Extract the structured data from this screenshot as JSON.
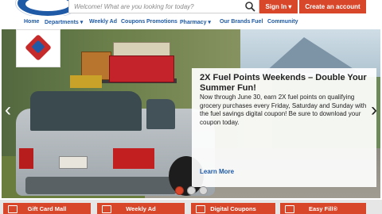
{
  "header": {
    "search_placeholder": "Welcome! What are you looking for today?",
    "signin_label": "Sign In ▾",
    "create_account_label": "Create an account"
  },
  "nav": {
    "items": [
      {
        "label": "Home"
      },
      {
        "label": "Departments ▾"
      },
      {
        "label": "Weekly Ad"
      },
      {
        "label": "Coupons"
      },
      {
        "label": "Promotions"
      },
      {
        "label": "Pharmacy ▾"
      },
      {
        "label": "Our Brands"
      },
      {
        "label": "Fuel"
      },
      {
        "label": "Community"
      }
    ]
  },
  "hero": {
    "title": "2X Fuel Points Weekends – Double Your Summer Fun!",
    "body": "Now through June 30, earn 2X fuel points on qualifying grocery purchases every Friday, Saturday and Sunday with the fuel savings digital coupon! Be sure to download your coupon today.",
    "cta": "Learn More",
    "slides": 3,
    "active_slide": 1
  },
  "bottom_tiles": [
    {
      "label": "Gift Card Mall"
    },
    {
      "label": "Weekly Ad"
    },
    {
      "label": "Digital Coupons"
    },
    {
      "label": "Easy Fill®"
    }
  ],
  "colors": {
    "accent": "#d9472b",
    "brand_blue": "#1f5aa6"
  }
}
